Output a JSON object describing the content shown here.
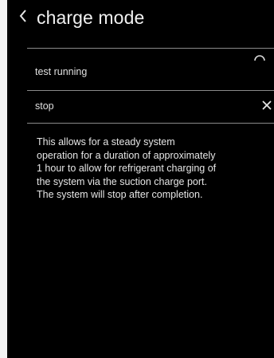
{
  "header": {
    "back_icon": "chevron-left-icon",
    "title": "charge mode"
  },
  "options": [
    {
      "label": "test running",
      "icon": "loading-spinner-icon"
    },
    {
      "label": "stop",
      "icon": "close-icon"
    }
  ],
  "description": "This allows for a steady system\noperation for a duration of approximately\n1 hour to allow for refrigerant charging of\nthe system via the suction charge port.\nThe system will stop after completion.",
  "colors": {
    "background": "#000000",
    "text": "#e8e8e8",
    "divider": "#8a8a8a"
  }
}
